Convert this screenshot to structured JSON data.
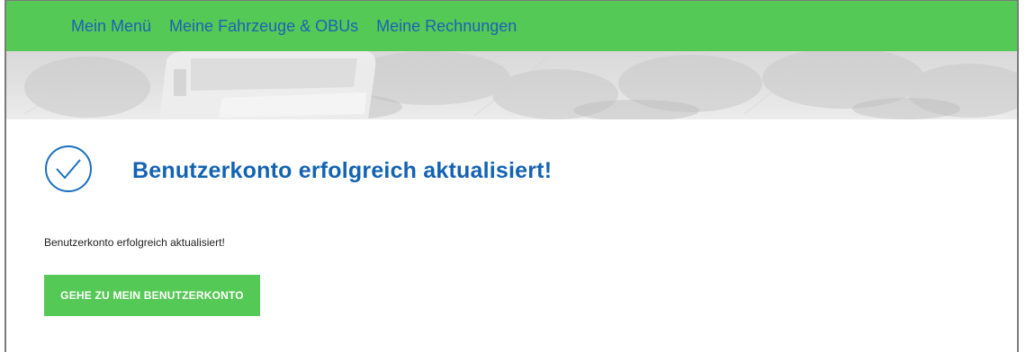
{
  "nav": {
    "items": [
      {
        "label": "Mein Menü"
      },
      {
        "label": "Meine Fahrzeuge & OBUs"
      },
      {
        "label": "Meine Rechnungen"
      }
    ]
  },
  "confirmation": {
    "title": "Benutzerkonto erfolgreich aktualisiert!",
    "message": "Benutzerkonto erfolgreich aktualisiert!",
    "button_label": "GEHE ZU MEIN BENUTZERKONTO",
    "icon": "check-circle-icon"
  },
  "colors": {
    "nav_background": "#55c955",
    "nav_link": "#1b63b5",
    "title": "#1363b3",
    "button_background": "#55c955",
    "button_text": "#ffffff"
  }
}
